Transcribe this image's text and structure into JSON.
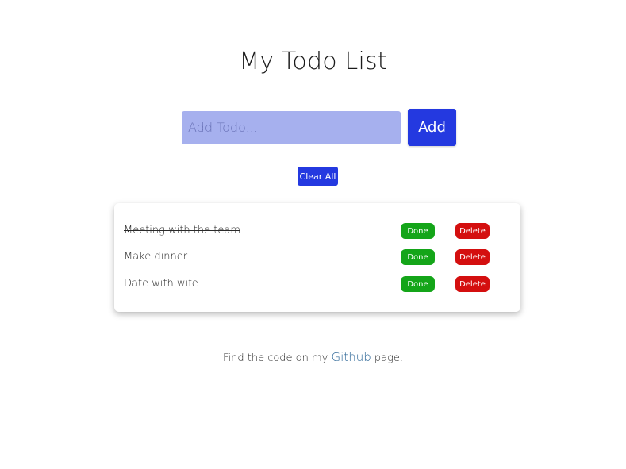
{
  "header": {
    "title": "My Todo List"
  },
  "add_form": {
    "input_value": "",
    "input_placeholder": "Add Todo...",
    "add_label": "Add"
  },
  "clear_all_label": "Clear All",
  "todos": [
    {
      "text": "Meeting with the team",
      "completed": true,
      "done_label": "Done",
      "delete_label": "Delete"
    },
    {
      "text": "Make dinner",
      "completed": false,
      "done_label": "Done",
      "delete_label": "Delete"
    },
    {
      "text": "Date with wife",
      "completed": false,
      "done_label": "Done",
      "delete_label": "Delete"
    }
  ],
  "footer": {
    "prefix": "Find the code on my ",
    "link_text": "Github",
    "suffix": " page."
  },
  "colors": {
    "primary_blue": "#2439e0",
    "input_background": "#a6b0ee",
    "done_green": "#14a519",
    "delete_red": "#d40f0f",
    "link_blue": "#2b6596"
  }
}
